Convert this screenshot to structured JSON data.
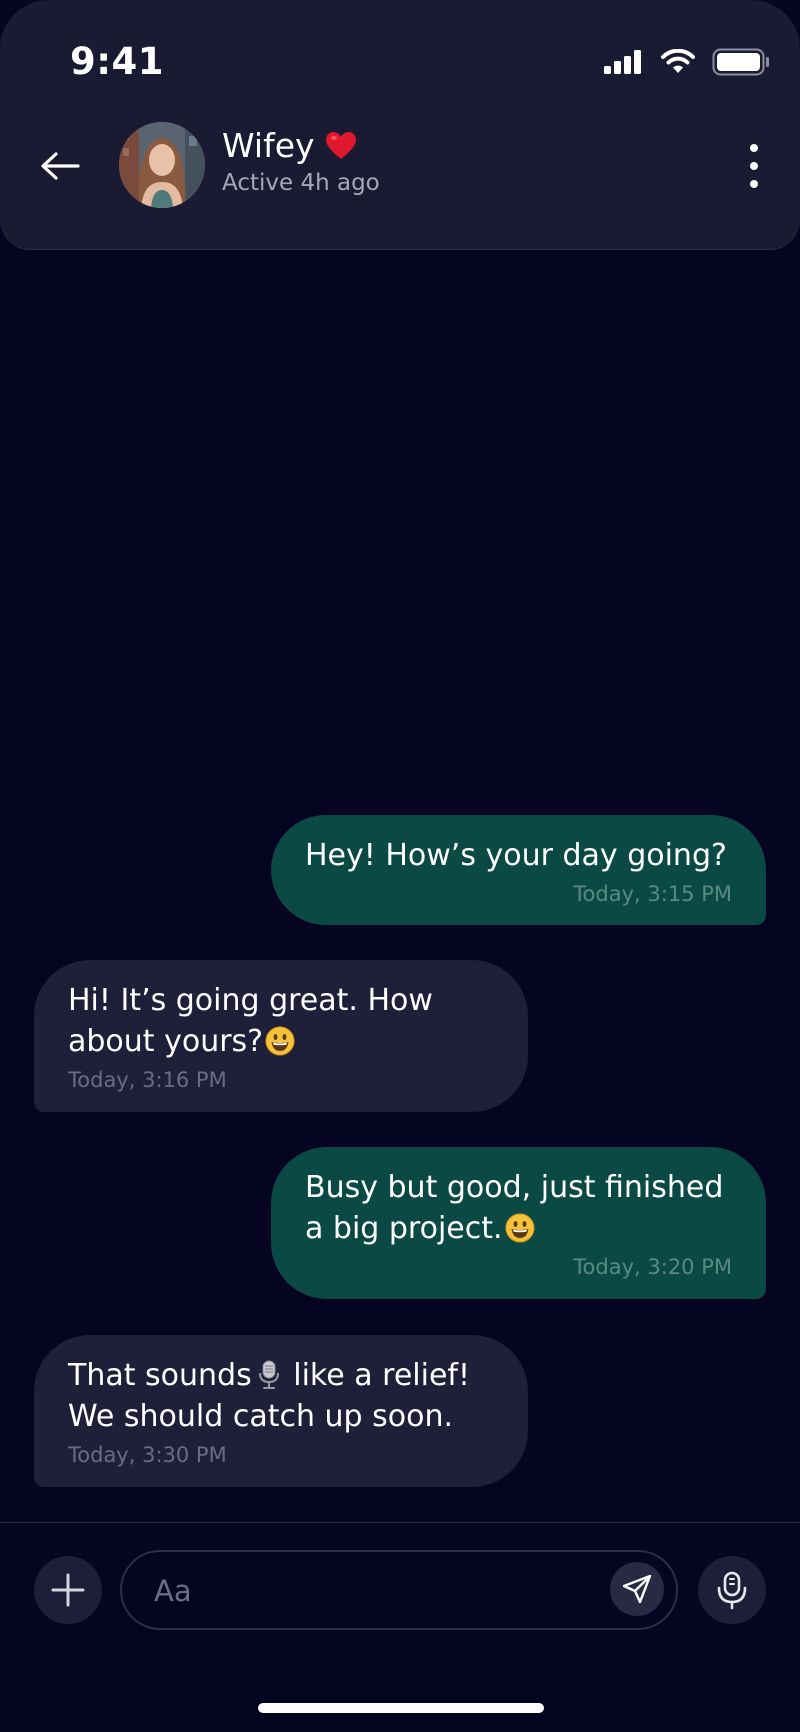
{
  "status_bar": {
    "time": "9:41"
  },
  "header": {
    "contact_name": "Wifey",
    "contact_status": "Active 4h ago",
    "back_icon": "arrow-left-icon",
    "menu_icon": "more-vertical-icon"
  },
  "messages": [
    {
      "direction": "out",
      "text": "Hey! How’s your day going?",
      "time": "Today, 3:15 PM"
    },
    {
      "direction": "in",
      "text": "Hi! It’s going great. How\nabout yours?",
      "emoji": "grinning-face",
      "time": "Today, 3:16 PM"
    },
    {
      "direction": "out",
      "text": "Busy but good, just finished\na big project.",
      "emoji": "grinning-face",
      "time": "Today, 3:20 PM"
    },
    {
      "direction": "in",
      "text_a": "That sounds",
      "emoji": "microphone",
      "text_b": " like a relief!\nWe should catch up soon.",
      "time": "Today, 3:30 PM"
    }
  ],
  "composer": {
    "placeholder": "Aa",
    "add_icon": "plus-icon",
    "send_icon": "send-icon",
    "mic_icon": "microphone-icon"
  },
  "colors": {
    "background": "#050521",
    "header": "#1b1a33",
    "outgoing_bubble": "#0b4a44",
    "incoming_bubble": "#201f3a",
    "heart": "#e0182d"
  }
}
